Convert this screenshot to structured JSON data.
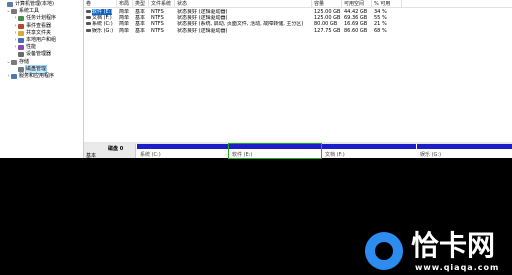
{
  "tree": [
    {
      "label": "计算机管理(本地)",
      "arrow": "",
      "icon_color": "#5a7da8",
      "depth": 0
    },
    {
      "label": "系统工具",
      "arrow": "⌄",
      "icon_color": "#7a7a7a",
      "depth": 1
    },
    {
      "label": "任务计划程序",
      "arrow": "›",
      "icon_color": "#4a8a4a",
      "depth": 2
    },
    {
      "label": "事件查看器",
      "arrow": "›",
      "icon_color": "#b04a2a",
      "depth": 2
    },
    {
      "label": "共享文件夹",
      "arrow": "›",
      "icon_color": "#d8a838",
      "depth": 2
    },
    {
      "label": "本地用户和组",
      "arrow": "›",
      "icon_color": "#4a6ab0",
      "depth": 2
    },
    {
      "label": "性能",
      "arrow": "›",
      "icon_color": "#8a4ab0",
      "depth": 2
    },
    {
      "label": "设备管理器",
      "arrow": "",
      "icon_color": "#6a6a6a",
      "depth": 2
    },
    {
      "label": "存储",
      "arrow": "⌄",
      "icon_color": "#7a7a7a",
      "depth": 1
    },
    {
      "label": "磁盘管理",
      "arrow": "",
      "icon_color": "#6a7a8a",
      "depth": 2,
      "selected": true
    },
    {
      "label": "服务和应用程序",
      "arrow": "›",
      "icon_color": "#4a7ab0",
      "depth": 1
    }
  ],
  "columns": [
    "卷",
    "布局",
    "类型",
    "文件系统",
    "状态",
    "容量",
    "可用空间",
    "% 可用"
  ],
  "volumes": [
    {
      "cells": [
        "软件 (E:)",
        "简单",
        "基本",
        "NTFS",
        "状态良好 (逻辑驱动器)",
        "125.00 GB",
        "44.42 GB",
        "34 %"
      ],
      "selected": true
    },
    {
      "cells": [
        "文档 (F:)",
        "简单",
        "基本",
        "NTFS",
        "状态良好 (逻辑驱动器)",
        "125.00 GB",
        "69.36 GB",
        "55 %"
      ]
    },
    {
      "cells": [
        "系统 (C:)",
        "简单",
        "基本",
        "NTFS",
        "状态良好 (系统, 启动, 页面文件, 活动, 故障转储, 主分区)",
        "80.00 GB",
        "16.69 GB",
        "21 %"
      ]
    },
    {
      "cells": [
        "娱乐 (G:)",
        "简单",
        "基本",
        "NTFS",
        "状态良好 (逻辑驱动器)",
        "127.75 GB",
        "86.60 GB",
        "68 %"
      ]
    }
  ],
  "disk": {
    "name": "磁盘 0",
    "type": "基本",
    "partitions": [
      {
        "label": "系统 (C:)"
      },
      {
        "label": "软件 (E:)",
        "selected": true
      },
      {
        "label": "文档 (F:)"
      },
      {
        "label": "娱乐 (G:)"
      }
    ]
  },
  "watermark": {
    "brand": "恰卡网",
    "url": "www.qiaqa.com",
    "accent": "#2d8cf0"
  }
}
